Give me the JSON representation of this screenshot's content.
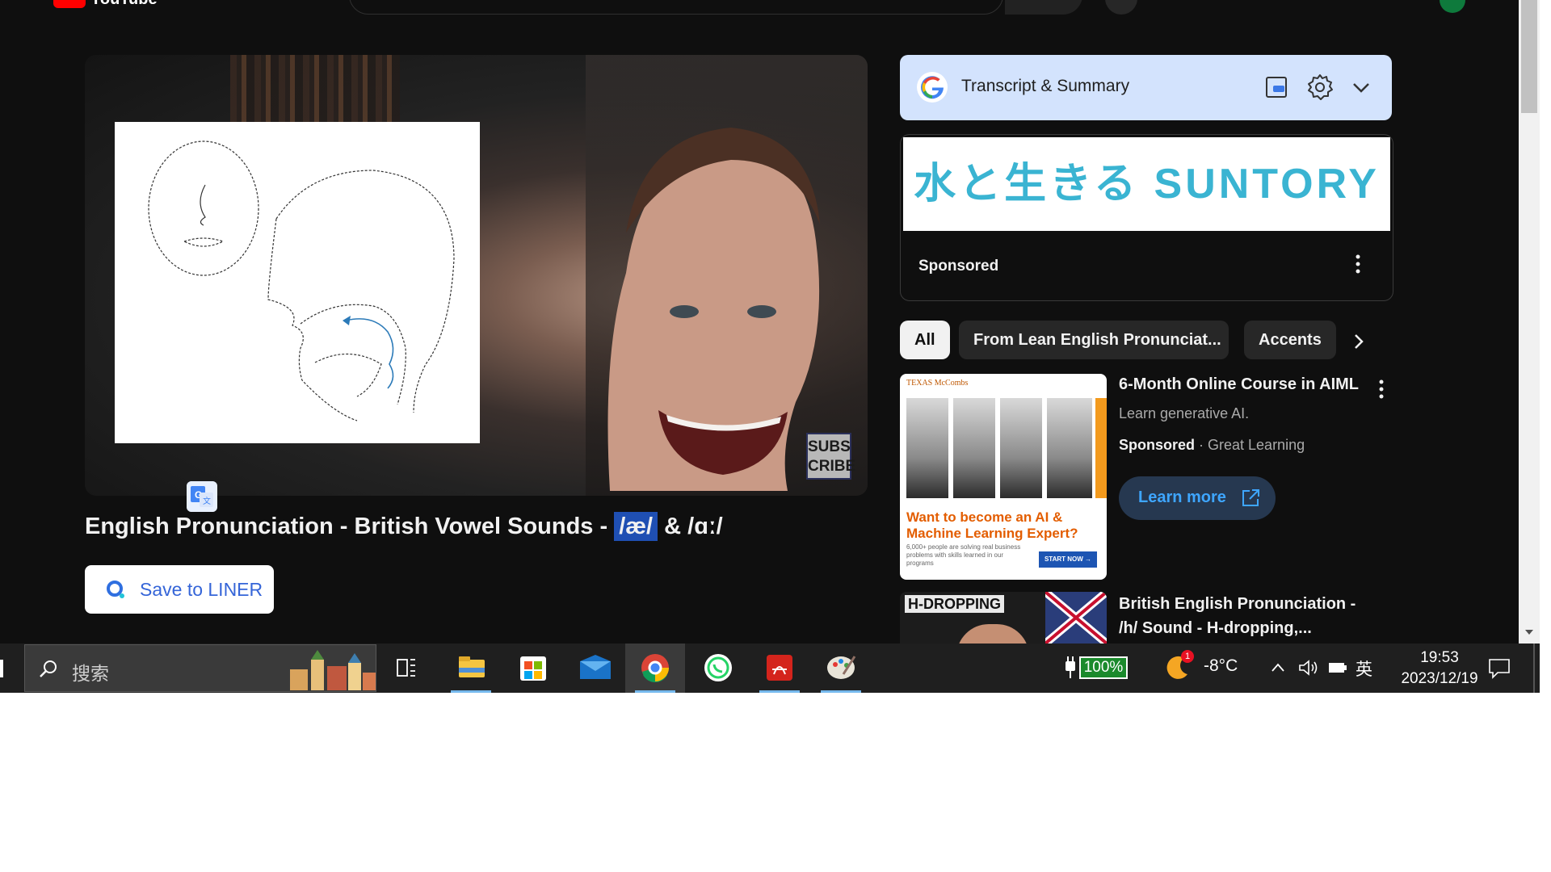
{
  "header": {
    "logo_text": "YouTube"
  },
  "video": {
    "title_prefix": "English Pronunciation - British Vowel Sounds - ",
    "title_highlight": "/æ/",
    "title_suffix": " & /ɑː/",
    "subscribe_badge_line1": "SUBS",
    "subscribe_badge_line2": "CRIBE"
  },
  "liner": {
    "label": "Save to LINER"
  },
  "transcript": {
    "label": "Transcript & Summary"
  },
  "ad_card": {
    "brand_text": "水と生きる SUNTORY",
    "sponsored_label": "Sponsored"
  },
  "chips": {
    "all": "All",
    "lean": "From Lean English Pronunciat...",
    "accents": "Accents"
  },
  "rec1": {
    "thumb_brand": "TEXAS McCombs",
    "thumb_headline": "Want to become an AI & Machine Learning Expert?",
    "thumb_small": "6,000+ people are solving real business problems with skills learned in our programs",
    "thumb_button": "START NOW →",
    "title": "6-Month Online Course in AIML",
    "description": "Learn generative AI.",
    "sponsored": "Sponsored",
    "separator": " · ",
    "channel": "Great Learning",
    "cta": "Learn more"
  },
  "rec2": {
    "badge": "H-DROPPING",
    "title": "British English Pronunciation - /h/ Sound - H-dropping,..."
  },
  "taskbar": {
    "search_placeholder": "搜索",
    "battery": "100%",
    "weather_badge": "1",
    "temperature": "-8°C",
    "ime": "英",
    "time": "19:53",
    "date": "2023/12/19"
  },
  "colors": {
    "accent_blue": "#3ea6ff",
    "transcript_bg": "#d3e3fd",
    "battery_green": "#1b8a2c"
  }
}
